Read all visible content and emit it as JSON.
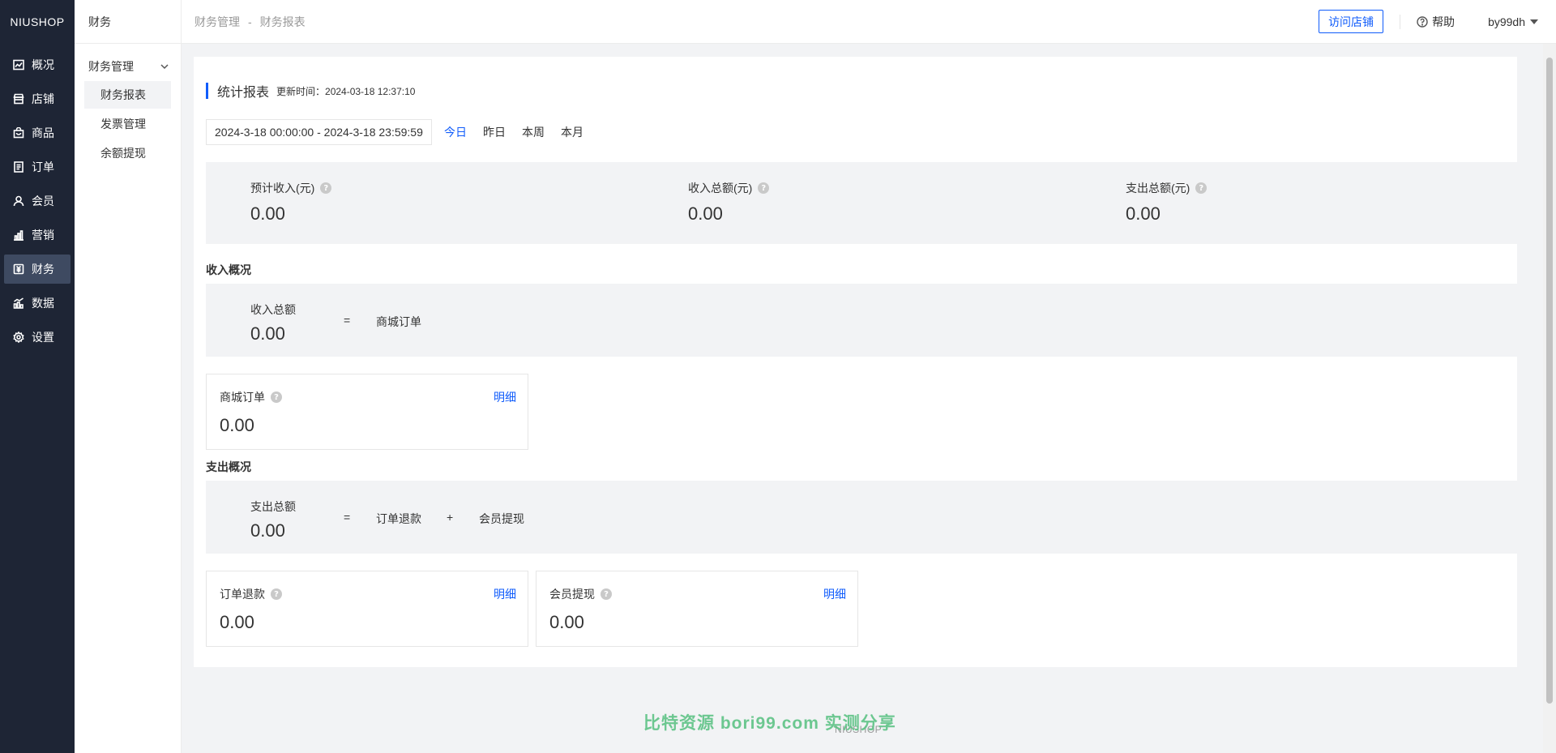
{
  "brand": {
    "logo": "NIUSHOP"
  },
  "nav": {
    "items": [
      {
        "label": "概况",
        "icon": "chart-line-icon"
      },
      {
        "label": "店铺",
        "icon": "store-icon"
      },
      {
        "label": "商品",
        "icon": "bag-icon"
      },
      {
        "label": "订单",
        "icon": "document-icon"
      },
      {
        "label": "会员",
        "icon": "user-icon"
      },
      {
        "label": "营销",
        "icon": "bar-chart-icon"
      },
      {
        "label": "财务",
        "icon": "finance-icon",
        "active": true
      },
      {
        "label": "数据",
        "icon": "data-icon"
      },
      {
        "label": "设置",
        "icon": "gear-icon"
      }
    ]
  },
  "subnav": {
    "title": "财务",
    "group": "财务管理",
    "items": [
      {
        "label": "财务报表",
        "active": true
      },
      {
        "label": "发票管理"
      },
      {
        "label": "余额提现"
      }
    ]
  },
  "topbar": {
    "breadcrumb": [
      "财务管理",
      "财务报表"
    ],
    "breadcrumb_sep": "-",
    "visit_store": "访问店铺",
    "help": "帮助",
    "user": "by99dh"
  },
  "report": {
    "title": "统计报表",
    "updated": "更新时间：2024-03-18 12:37:10",
    "date_range": "2024-3-18 00:00:00 - 2024-3-18 23:59:59",
    "quick_ranges": [
      "今日",
      "昨日",
      "本周",
      "本月"
    ],
    "summary": [
      {
        "label": "预计收入(元)",
        "value": "0.00"
      },
      {
        "label": "收入总额(元)",
        "value": "0.00"
      },
      {
        "label": "支出总额(元)",
        "value": "0.00"
      }
    ]
  },
  "income": {
    "heading": "收入概况",
    "total_label": "收入总额",
    "total_value": "0.00",
    "equals": "=",
    "terms": [
      "商城订单"
    ],
    "cards": [
      {
        "label": "商城订单",
        "value": "0.00",
        "detail": "明细"
      }
    ]
  },
  "expense": {
    "heading": "支出概况",
    "total_label": "支出总额",
    "total_value": "0.00",
    "equals": "=",
    "plus": "+",
    "terms": [
      "订单退款",
      "会员提现"
    ],
    "cards": [
      {
        "label": "订单退款",
        "value": "0.00",
        "detail": "明细"
      },
      {
        "label": "会员提现",
        "value": "0.00",
        "detail": "明细"
      }
    ]
  },
  "footer": {
    "logo": "NIUSHOP",
    "watermark": "比特资源  bori99.com  实测分享"
  },
  "colors": {
    "accent": "#105cfb",
    "nav_bg": "#1e2535",
    "nav_active": "#3e4a61",
    "panel_bg": "#f2f3f5"
  }
}
